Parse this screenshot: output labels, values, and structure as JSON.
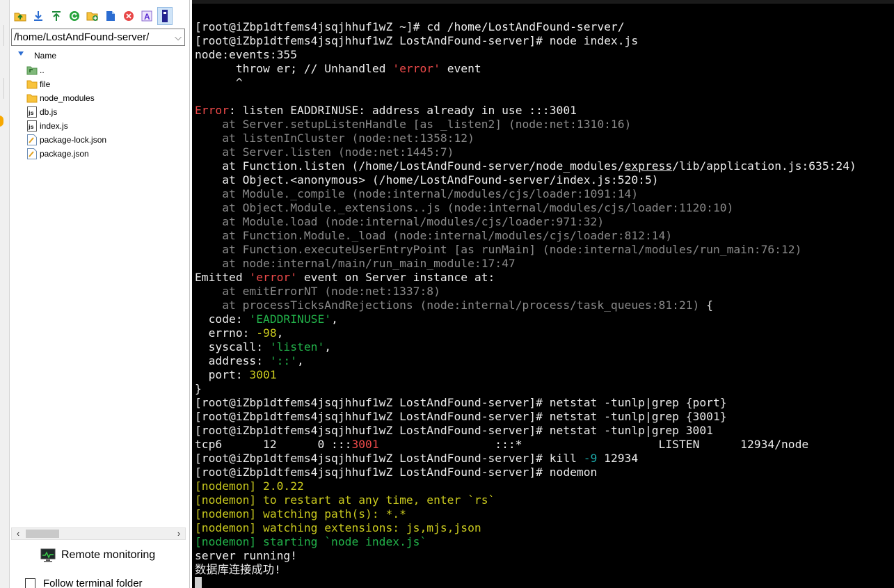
{
  "file_panel": {
    "path": "/home/LostAndFound-server/",
    "column_header": "Name",
    "items": [
      {
        "name": "..",
        "icon": "parent-folder-icon"
      },
      {
        "name": "file",
        "icon": "folder-icon"
      },
      {
        "name": "node_modules",
        "icon": "folder-icon"
      },
      {
        "name": "db.js",
        "icon": "js-file-icon"
      },
      {
        "name": "index.js",
        "icon": "js-file-icon"
      },
      {
        "name": "package-lock.json",
        "icon": "json-file-icon"
      },
      {
        "name": "package.json",
        "icon": "json-file-icon"
      }
    ],
    "remote_monitoring": "Remote monitoring",
    "follow_terminal_folder": "Follow terminal folder",
    "toolbar_icons": [
      "go-parent-icon",
      "download-icon",
      "upload-icon",
      "refresh-icon",
      "new-folder-icon",
      "new-file-icon",
      "delete-icon",
      "rename-icon",
      "terminal-icon"
    ]
  },
  "colors": {
    "folder": "#f8c33c",
    "terminal_bg": "#000000",
    "terminal_fg": "#ececec",
    "dim": "#8a8a8a",
    "error_red": "#ee4a4a",
    "number_yellow": "#c9c91e",
    "string_green": "#22b34a"
  },
  "terminal": {
    "lines": [
      [
        [
          "w",
          "[root@iZbp1dtfems4jsqjhhuf1wZ ~]# cd /home/LostAndFound-server/"
        ]
      ],
      [
        [
          "w",
          "[root@iZbp1dtfems4jsqjhhuf1wZ LostAndFound-server]# node index.js"
        ]
      ],
      [
        [
          "w",
          "node:events:355"
        ]
      ],
      [
        [
          "w",
          "      throw er; // Unhandled "
        ],
        [
          "r",
          "'error'"
        ],
        [
          "w",
          " event"
        ]
      ],
      [
        [
          "w",
          "      ^"
        ]
      ],
      [
        [
          "w",
          ""
        ]
      ],
      [
        [
          "r",
          "Error"
        ],
        [
          "w",
          ": listen EADDRINUSE: address already in use :::3001"
        ]
      ],
      [
        [
          "g",
          "    at Server.setupListenHandle [as _listen2] (node:net:1310:16)"
        ]
      ],
      [
        [
          "g",
          "    at listenInCluster (node:net:1358:12)"
        ]
      ],
      [
        [
          "g",
          "    at Server.listen (node:net:1445:7)"
        ]
      ],
      [
        [
          "w",
          "    at Function.listen (/home/LostAndFound-server/node_modules/"
        ],
        [
          "wu",
          "express"
        ],
        [
          "w",
          "/lib/application.js:635:24)"
        ]
      ],
      [
        [
          "w",
          "    at Object.<anonymous> (/home/LostAndFound-server/index.js:520:5)"
        ]
      ],
      [
        [
          "g",
          "    at Module._compile (node:internal/modules/cjs/loader:1091:14)"
        ]
      ],
      [
        [
          "g",
          "    at Object.Module._extensions..js (node:internal/modules/cjs/loader:1120:10)"
        ]
      ],
      [
        [
          "g",
          "    at Module.load (node:internal/modules/cjs/loader:971:32)"
        ]
      ],
      [
        [
          "g",
          "    at Function.Module._load (node:internal/modules/cjs/loader:812:14)"
        ]
      ],
      [
        [
          "g",
          "    at Function.executeUserEntryPoint [as runMain] (node:internal/modules/run_main:76:12)"
        ]
      ],
      [
        [
          "g",
          "    at node:internal/main/run_main_module:17:47"
        ]
      ],
      [
        [
          "w",
          "Emitted "
        ],
        [
          "r",
          "'error'"
        ],
        [
          "w",
          " event on Server instance at:"
        ]
      ],
      [
        [
          "g",
          "    at emitErrorNT (node:net:1337:8)"
        ]
      ],
      [
        [
          "g",
          "    at processTicksAndRejections (node:internal/process/task_queues:81:21)"
        ],
        [
          "w",
          " {"
        ]
      ],
      [
        [
          "w",
          "  code: "
        ],
        [
          "gr",
          "'EADDRINUSE'"
        ],
        [
          "w",
          ","
        ]
      ],
      [
        [
          "w",
          "  errno: "
        ],
        [
          "y",
          "-98"
        ],
        [
          "w",
          ","
        ]
      ],
      [
        [
          "w",
          "  syscall: "
        ],
        [
          "gr",
          "'listen'"
        ],
        [
          "w",
          ","
        ]
      ],
      [
        [
          "w",
          "  address: "
        ],
        [
          "gr",
          "'::'"
        ],
        [
          "w",
          ","
        ]
      ],
      [
        [
          "w",
          "  port: "
        ],
        [
          "y",
          "3001"
        ]
      ],
      [
        [
          "w",
          "}"
        ]
      ],
      [
        [
          "w",
          "[root@iZbp1dtfems4jsqjhhuf1wZ LostAndFound-server]# netstat -tunlp|grep {port}"
        ]
      ],
      [
        [
          "w",
          "[root@iZbp1dtfems4jsqjhhuf1wZ LostAndFound-server]# netstat -tunlp|grep {3001}"
        ]
      ],
      [
        [
          "w",
          "[root@iZbp1dtfems4jsqjhhuf1wZ LostAndFound-server]# netstat -tunlp|grep 3001"
        ]
      ],
      [
        [
          "w",
          "tcp6      12      0 :::"
        ],
        [
          "r",
          "3001"
        ],
        [
          "w",
          "                 :::*                    LISTEN      12934/node"
        ]
      ],
      [
        [
          "w",
          "[root@iZbp1dtfems4jsqjhhuf1wZ LostAndFound-server]# kill "
        ],
        [
          "c",
          "-9"
        ],
        [
          "w",
          " 12934"
        ]
      ],
      [
        [
          "w",
          "[root@iZbp1dtfems4jsqjhhuf1wZ LostAndFound-server]# nodemon"
        ]
      ],
      [
        [
          "y",
          "[nodemon] 2.0.22"
        ]
      ],
      [
        [
          "y",
          "[nodemon] to restart at any time, enter `rs`"
        ]
      ],
      [
        [
          "y",
          "[nodemon] watching path(s): *.*"
        ]
      ],
      [
        [
          "y",
          "[nodemon] watching extensions: js,mjs,json"
        ]
      ],
      [
        [
          "gr",
          "[nodemon] starting `node index.js`"
        ]
      ],
      [
        [
          "w",
          "server running!"
        ]
      ],
      [
        [
          "w",
          "数据库连接成功!"
        ]
      ]
    ]
  }
}
